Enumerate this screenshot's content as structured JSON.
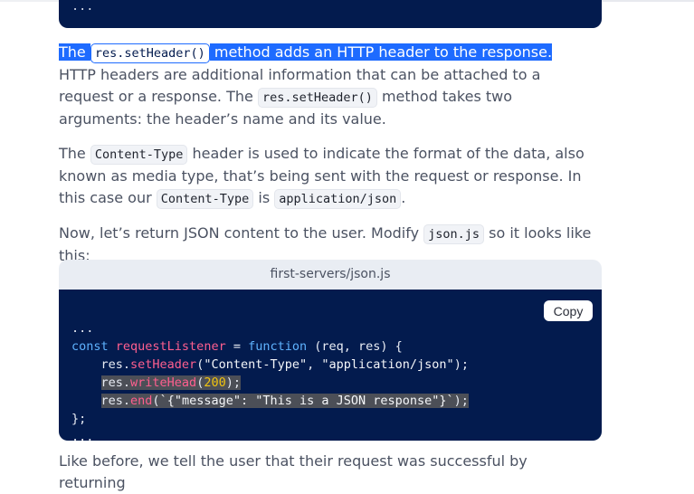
{
  "top_code": {
    "ellipsis": "..."
  },
  "paragraph1": {
    "hl_the": "The ",
    "hl_code": "res.setHeader()",
    "hl_rest": " method adds an HTTP header to the response.",
    "rest_before": " HTTP headers are additional information that can be attached to a request or a response. The ",
    "code2": "res.setHeader()",
    "rest_after": " method takes two arguments: the header’s name and its value."
  },
  "paragraph2": {
    "t1": "The ",
    "code1": "Content-Type",
    "t2": " header is used to indicate the format of the data, also known as media type, that’s being sent with the request or response. In this case our ",
    "code2": "Content-Type",
    "t3": " is ",
    "code3": "application/json",
    "t4": "."
  },
  "paragraph3": {
    "t1": "Now, let’s return JSON content to the user. Modify ",
    "code1": "json.js",
    "t2": " so it looks like this:"
  },
  "file_label": "first-servers/json.js",
  "copy_label": "Copy",
  "code": {
    "l1": "...",
    "kw_const": "const",
    "var_name": "requestListener",
    "eq": " = ",
    "kw_function": "function",
    "params": " (req, res) {",
    "l3_obj": "res.",
    "l3_fn": "setHeader",
    "l3_open": "(",
    "l3_arg1": "\"Content-Type\"",
    "l3_sep": ", ",
    "l3_arg2": "\"application/json\"",
    "l3_close": ");",
    "l4_obj": "res.",
    "l4_fn": "writeHead",
    "l4_open": "(",
    "l4_num": "200",
    "l4_close": ");",
    "l5_obj": "res.",
    "l5_fn": "end",
    "l5_open": "(",
    "l5_str": "`{\"message\": \"This is a JSON response\"}`",
    "l5_close": ");",
    "l6": "};",
    "l7": "..."
  },
  "paragraph4": {
    "text": "Like before, we tell the user that their request was successful by returning"
  }
}
